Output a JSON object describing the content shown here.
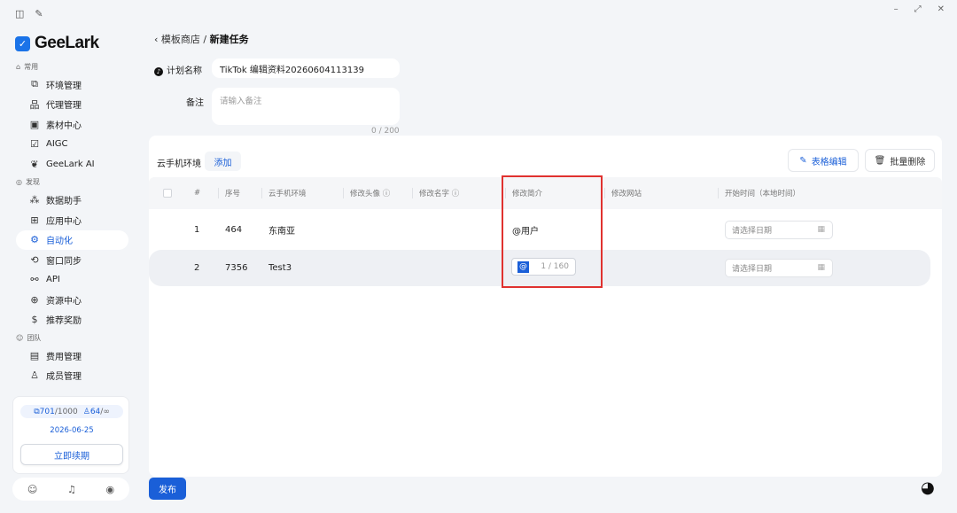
{
  "app": {
    "logo_text": "GeeLark"
  },
  "sidebar": {
    "sections": [
      {
        "label": "常用",
        "items": [
          {
            "label": "环境管理",
            "icon": "window-icon"
          },
          {
            "label": "代理管理",
            "icon": "network-icon"
          },
          {
            "label": "素材中心",
            "icon": "material-icon"
          },
          {
            "label": "AIGC",
            "icon": "aigc-icon"
          },
          {
            "label": "GeeLark AI",
            "icon": "ai-icon"
          }
        ]
      },
      {
        "label": "发现",
        "items": [
          {
            "label": "数据助手",
            "icon": "data-icon"
          },
          {
            "label": "应用中心",
            "icon": "apps-icon"
          },
          {
            "label": "自动化",
            "icon": "automation-icon",
            "active": true
          },
          {
            "label": "窗口同步",
            "icon": "sync-icon"
          },
          {
            "label": "API",
            "icon": "api-icon"
          },
          {
            "label": "资源中心",
            "icon": "resource-icon"
          },
          {
            "label": "推荐奖励",
            "icon": "reward-icon"
          }
        ]
      },
      {
        "label": "团队",
        "items": [
          {
            "label": "费用管理",
            "icon": "billing-icon"
          },
          {
            "label": "成员管理",
            "icon": "members-icon"
          }
        ]
      }
    ],
    "quota": {
      "profiles_used": "701",
      "profiles_total": "/1000",
      "members_used": "64",
      "members_total": "/∞",
      "date": "2026-06-25",
      "renew_label": "立即续期"
    }
  },
  "breadcrumb": {
    "back": "‹",
    "parent": "模板商店",
    "sep": "/",
    "current": "新建任务"
  },
  "form": {
    "plan_name_label": "计划名称",
    "plan_name_value": "TikTok 编辑资料20260604113139",
    "note_label": "备注",
    "note_placeholder": "请输入备注",
    "note_counter": "0 / 200"
  },
  "panel": {
    "title": "云手机环境",
    "add_label": "添加",
    "table_edit_label": "表格编辑",
    "batch_delete_label": "批量删除",
    "columns": [
      "#",
      "序号",
      "云手机环境",
      "修改头像 ⓘ",
      "修改名字 ⓘ",
      "修改简介",
      "修改网站",
      "开始时间（本地时间）"
    ],
    "rows": [
      {
        "index": "1",
        "serial": "464",
        "env": "东南亚",
        "bio": "@用户",
        "date_placeholder": "请选择日期"
      },
      {
        "index": "2",
        "serial": "7356",
        "env": "Test3",
        "bio_edit": "@",
        "bio_count": "1 / 160",
        "date_placeholder": "请选择日期"
      }
    ]
  },
  "footer": {
    "publish_label": "发布"
  },
  "window": {
    "min": "–",
    "max": "⤢",
    "close": "✕"
  }
}
